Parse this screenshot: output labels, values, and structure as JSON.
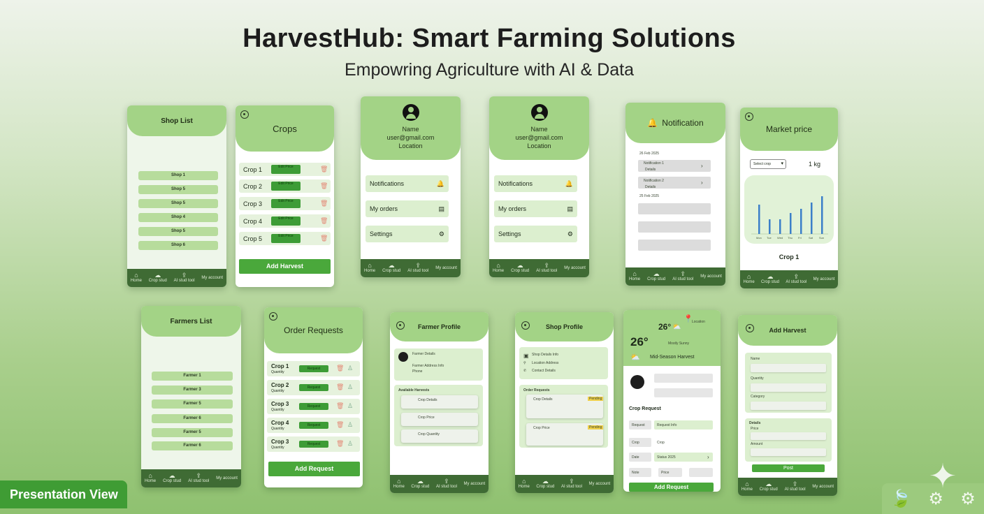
{
  "title": "HarvestHub: Smart Farming Solutions",
  "subtitle": "Empowring Agriculture with AI & Data",
  "nav": [
    "Home",
    "Crop stud",
    "AI stud tool",
    "My account"
  ],
  "shop_list": {
    "title": "Shop List",
    "items": [
      "Shop 1",
      "Shop 5",
      "Shop 5",
      "Shop 4",
      "Shop 5",
      "Shop 6"
    ]
  },
  "crops": {
    "title": "Crops",
    "items": [
      "Crop 1",
      "Crop 2",
      "Crop 3",
      "Crop 4",
      "Crop 5"
    ],
    "chip": "Edit Price",
    "cta": "Add Harvest"
  },
  "profile_a": {
    "name": "Name",
    "email": "user@gmail.com",
    "location": "Location",
    "menu": [
      "Notifications",
      "My orders",
      "Settings"
    ]
  },
  "profile_b": {
    "name": "Name",
    "email": "user@gmail.com",
    "location": "Location",
    "menu": [
      "Notifications",
      "My orders",
      "Settings"
    ]
  },
  "notification": {
    "title": "Notification",
    "date1": "26 Feb 2025",
    "item1": "Notification 1",
    "item1_sub": "Details",
    "item2": "Notification 2",
    "item2_sub": "Details",
    "date2": "25 Feb 2025"
  },
  "market": {
    "title": "Market price",
    "select": "Select crop",
    "unit": "1 kg",
    "crop": "Crop 1",
    "bars": [
      28,
      14,
      14,
      20,
      24,
      30,
      36
    ],
    "ticks": [
      "Mon",
      "Tue",
      "Wed",
      "Thu",
      "Fri",
      "Sat",
      "Sun"
    ]
  },
  "farmers_list": {
    "title": "Farmers List",
    "items": [
      "Farmer 1",
      "Farmer 3",
      "Farmer 5",
      "Farmer 6",
      "Farmer 5",
      "Farmer 6"
    ]
  },
  "order_requests": {
    "title": "Order Requests",
    "items": [
      "Crop 1",
      "Crop 2",
      "Crop 3",
      "Crop 4",
      "Crop 3"
    ],
    "sub": "Quantity",
    "chip": "Request",
    "cta": "Add Request"
  },
  "farmer_profile": {
    "title": "Farmer Profile",
    "name": "Farmer Details",
    "info": "Farmer Address Info",
    "phone": "Phone",
    "section": "Available Harvests",
    "cards": [
      "Crop Details",
      "Crop Price",
      "Crop Quantity"
    ]
  },
  "shop_profile": {
    "title": "Shop Profile",
    "line1": "Shop Details Info",
    "line2": "Location Address",
    "line3": "Contact Details",
    "section": "Order Requests",
    "cards": [
      "Crop Details",
      "Crop Price"
    ],
    "status": "Pending"
  },
  "weather": {
    "temp_small": "26°",
    "location": "Location",
    "temp_big": "26°",
    "desc": "Mostly Sunny",
    "forecast": "Mid-Season Harvest",
    "section": "Crop Request",
    "labels": [
      "Request",
      "Crop",
      "Date",
      "Note"
    ],
    "values": [
      "Request Info",
      "Crop",
      "Status 2025",
      "Price"
    ],
    "cta": "Add Request"
  },
  "add_harvest": {
    "title": "Add Harvest",
    "fields": [
      "Name",
      "Quantity",
      "Category"
    ],
    "section": "Details",
    "fields2": [
      "Price",
      "Amount"
    ],
    "cta": "Post"
  },
  "badge": "Presentation View"
}
